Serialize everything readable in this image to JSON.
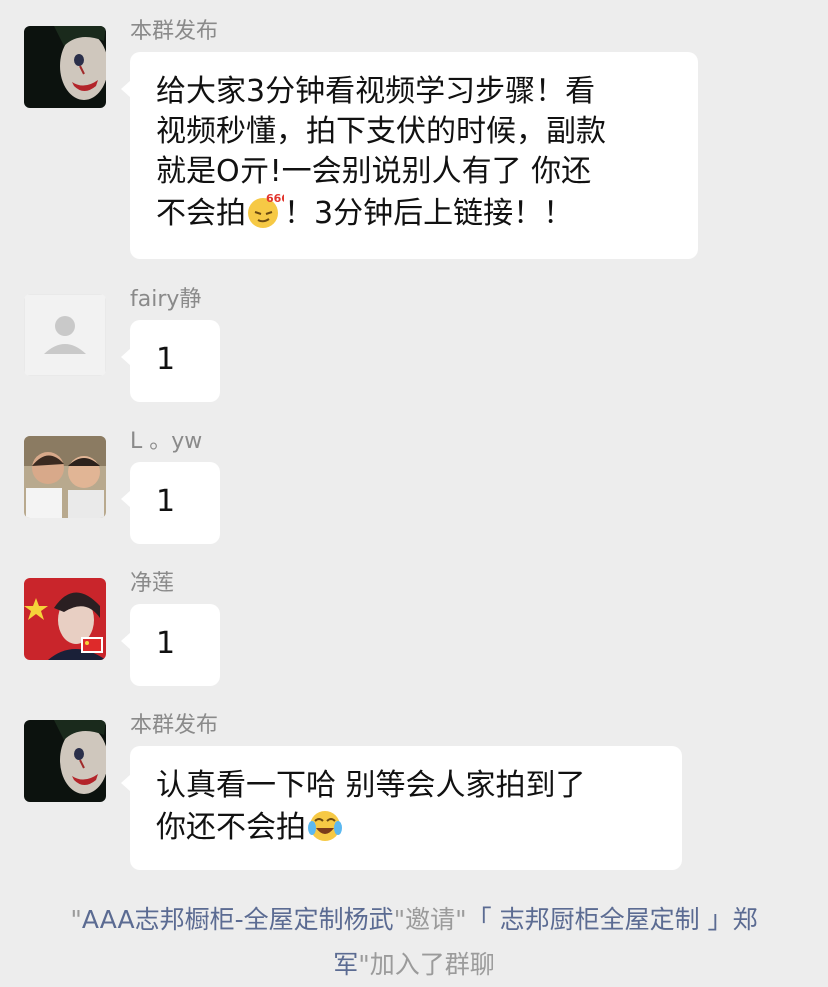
{
  "messages": [
    {
      "sender": "本群发布",
      "avatar": "joker-face-avatar",
      "lines": [
        "给大家3分钟看视频学习步骤！看",
        "视频秒懂，拍下支伏的时候，副款",
        "就是O亓!一会别说别人有了 你还",
        "不会拍"
      ],
      "emoji": "666-face-emoji",
      "tail": "！3分钟后上链接！！"
    },
    {
      "sender": "fairy静",
      "avatar": "default-person-avatar",
      "text": "1"
    },
    {
      "sender": "L 。yw",
      "avatar": "kids-photo-avatar",
      "text": "1"
    },
    {
      "sender": "净莲",
      "avatar": "china-flag-portrait-avatar",
      "text": "1"
    },
    {
      "sender": "本群发布",
      "avatar": "joker-face-avatar",
      "line1": "认真看一下哈 别等会人家拍到了",
      "line2": "你还不会拍",
      "emoji": "laughing-crying-emoji"
    }
  ],
  "system_notice": {
    "q1": "\"",
    "inviter": "AAA志邦橱柜-全屋定制杨武",
    "invite_text": "\"邀请\"",
    "invitee": "「 志邦厨柜全屋定制 」郑军",
    "join_text": "\"加入了群聊"
  },
  "colors": {
    "background": "#ededed",
    "bubble": "#ffffff",
    "sender_name": "#8a8a8a",
    "system_link": "#5b6b92"
  }
}
